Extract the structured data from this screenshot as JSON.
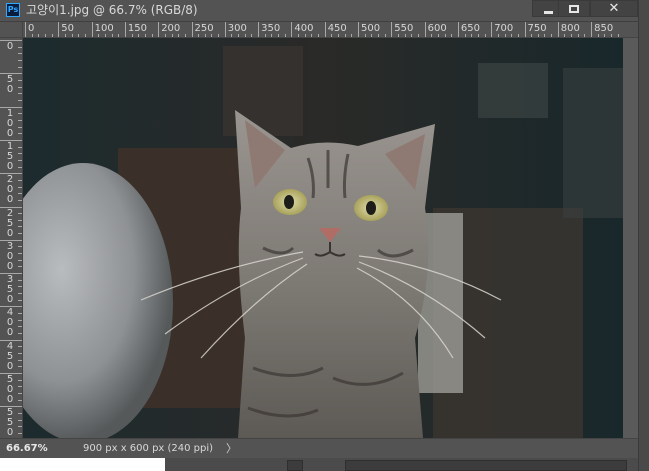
{
  "window": {
    "app_badge": "Ps",
    "title": "고양이1.jpg @ 66.7% (RGB/8)",
    "buttons": {
      "close_glyph": "✕"
    }
  },
  "ruler": {
    "horizontal_labels": [
      "0",
      "50",
      "100",
      "150",
      "200",
      "250",
      "300",
      "350",
      "400",
      "450",
      "500",
      "550",
      "600",
      "650",
      "700",
      "750",
      "800",
      "850"
    ],
    "vertical_labels": [
      "0",
      "50",
      "100",
      "150",
      "200",
      "250",
      "300",
      "350",
      "400",
      "450",
      "500",
      "550"
    ]
  },
  "canvas": {
    "image": "tabby-cat-photo"
  },
  "status": {
    "zoom": "66.67%",
    "doc_info": "900 px x 600 px (240 ppi)",
    "arrow": "〉"
  },
  "icons": [
    "photoshop-icon",
    "minimize-icon",
    "maximize-icon",
    "close-icon",
    "status-menu-arrow-icon"
  ],
  "colors": {
    "ui_bg": "#535353",
    "ps_blue": "#31a8ff",
    "ps_dark": "#0a1e3c"
  }
}
